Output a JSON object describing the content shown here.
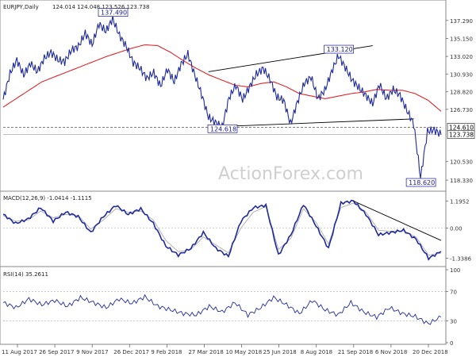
{
  "chart_data": [
    {
      "type": "line",
      "panel": "price",
      "header": {
        "symbol": "EURJPY,Daily",
        "ohlc": "124.014 124.048 123.526 123.738"
      },
      "watermark": "ActionForex.com",
      "y_ticks": [
        "137.290",
        "135.150",
        "133.020",
        "130.930",
        "128.820",
        "126.730",
        "124.610",
        "123.738",
        "120.530",
        "118.330"
      ],
      "ylim": [
        117.3,
        138.4
      ],
      "x_ticks": [
        "11 Aug 2017",
        "26 Sep 2017",
        "9 Nov 2017",
        "26 Dec 2017",
        "9 Feb 2018",
        "27 Mar 2018",
        "10 May 2018",
        "25 Jun 2018",
        "8 Aug 2018",
        "21 Sep 2018",
        "6 Nov 2018",
        "20 Dec 2018"
      ],
      "colors": {
        "price": "#1f2a9c",
        "ma": "#e0262a",
        "trend": "#000000",
        "hline": "#555555"
      },
      "price_series": [
        127.9,
        131.0,
        132.6,
        130.8,
        132.2,
        131.2,
        132.8,
        133.5,
        132.6,
        132.4,
        133.8,
        134.2,
        135.8,
        134.4,
        136.9,
        136.0,
        137.49,
        135.5,
        134.2,
        132.3,
        131.6,
        130.4,
        131.1,
        129.5,
        131.5,
        130.0,
        132.1,
        133.3,
        130.8,
        128.5,
        125.8,
        125.2,
        124.618,
        128.1,
        129.6,
        127.9,
        129.4,
        130.9,
        131.6,
        130.3,
        128.2,
        127.8,
        125.0,
        127.6,
        129.8,
        130.6,
        128.0,
        129.0,
        131.2,
        133.12,
        131.7,
        130.2,
        129.3,
        128.4,
        127.4,
        129.7,
        128.0,
        129.1,
        128.4,
        126.6,
        125.0,
        118.62,
        124.1,
        124.3,
        123.738
      ],
      "ma_series": [
        127.0,
        128.0,
        129.0,
        130.0,
        130.6,
        131.2,
        131.8,
        132.4,
        133.0,
        133.5,
        134.0,
        134.4,
        134.3,
        133.5,
        132.5,
        131.6,
        130.8,
        130.2,
        129.6,
        129.4,
        129.8,
        130.0,
        129.4,
        128.6,
        128.3,
        128.0,
        128.3,
        128.6,
        128.8,
        129.1,
        129.0,
        129.0,
        128.6,
        127.8,
        126.5
      ],
      "annotations": [
        {
          "label": "137.490",
          "value": 137.49
        },
        {
          "label": "133.120",
          "value": 133.12
        },
        {
          "label": "124.618",
          "value": 124.618
        },
        {
          "label": "118.620",
          "value": 118.62
        }
      ],
      "level_labels": {
        "support": "124.610",
        "last": "123.738"
      }
    },
    {
      "type": "line",
      "panel": "MACD",
      "header": "MACD(12,26,9) -1.0414 -1.1115",
      "y_ticks": [
        "1.1952",
        "0.00",
        "-1.3386"
      ],
      "ylim": [
        -1.6,
        1.45
      ],
      "colors": {
        "macd": "#1f2a9c",
        "signal": "#aaaaaa",
        "trend": "#000000"
      },
      "macd_series": [
        0.6,
        0.2,
        0.4,
        0.9,
        0.3,
        0.7,
        0.5,
        -0.2,
        0.5,
        1.0,
        0.6,
        0.85,
        0.2,
        -0.8,
        -1.2,
        -0.9,
        -0.2,
        -0.9,
        -1.25,
        0.3,
        0.9,
        1.0,
        -1.2,
        -0.3,
        1.05,
        0.1,
        -0.9,
        1.1,
        1.1953,
        0.6,
        -0.3,
        -0.2,
        -0.1,
        -0.5,
        -1.3386,
        -1.0414
      ],
      "signal_series": [
        0.55,
        0.3,
        0.35,
        0.75,
        0.45,
        0.6,
        0.55,
        -0.05,
        0.35,
        0.85,
        0.7,
        0.75,
        0.35,
        -0.55,
        -1.05,
        -0.95,
        -0.4,
        -0.75,
        -1.1,
        0.0,
        0.7,
        0.95,
        -0.95,
        -0.45,
        0.85,
        0.25,
        -0.7,
        0.9,
        1.1,
        0.7,
        -0.1,
        -0.15,
        -0.12,
        -0.4,
        -1.2,
        -1.1115
      ]
    },
    {
      "type": "line",
      "panel": "RSI",
      "header": "RSI(14) 35.2611",
      "y_ticks": [
        "100",
        "70",
        "30",
        "0"
      ],
      "ylim": [
        0,
        100
      ],
      "colors": {
        "rsi": "#1f2a9c",
        "levels": "#aaaaaa"
      },
      "rsi_series": [
        55,
        48,
        60,
        52,
        58,
        50,
        62,
        55,
        48,
        60,
        54,
        63,
        50,
        45,
        40,
        38,
        50,
        42,
        55,
        38,
        48,
        62,
        52,
        40,
        58,
        45,
        38,
        55,
        42,
        35,
        48,
        40,
        36,
        26,
        35.2611
      ]
    }
  ]
}
